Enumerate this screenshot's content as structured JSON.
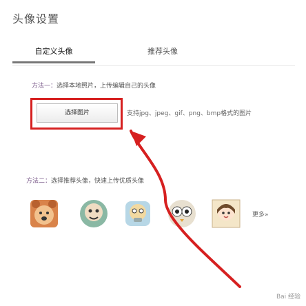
{
  "page": {
    "title": "头像设置"
  },
  "tabs": [
    {
      "label": "自定义头像"
    },
    {
      "label": "推荐头像"
    }
  ],
  "method1": {
    "prefix": "方法一：",
    "text": "选择本地照片，上传编辑自己的头像"
  },
  "upload": {
    "button_label": "选择图片",
    "hint": "支持jpg、jpeg、gif、png、bmp格式的图片"
  },
  "method2": {
    "prefix": "方法二：",
    "text": "选择推荐头像，快速上传优质头像"
  },
  "avatars": [
    {
      "name": "cartoon-bear"
    },
    {
      "name": "cartoon-monkey"
    },
    {
      "name": "cartoon-robot"
    },
    {
      "name": "cartoon-owl"
    },
    {
      "name": "cartoon-girl"
    }
  ],
  "more_label": "更多»",
  "watermark": "Bai 经验",
  "colors": {
    "annotation": "#d62020",
    "tab_underline": "#777777"
  }
}
